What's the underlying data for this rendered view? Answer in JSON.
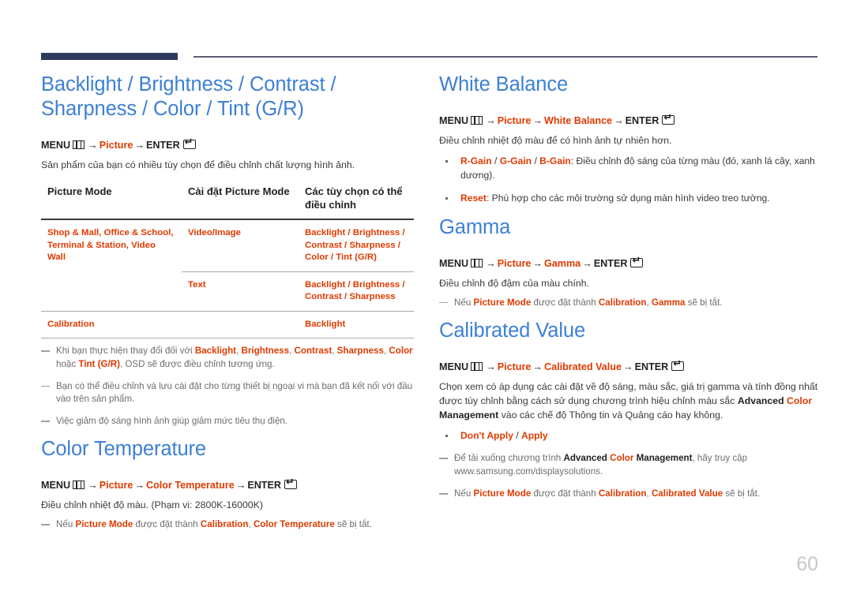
{
  "page": {
    "number": "60"
  },
  "icons": {
    "menu": "menu-icon",
    "enter": "enter-icon"
  },
  "labels": {
    "menu": "MENU",
    "enter": "ENTER",
    "arrow": "→",
    "picture": "Picture"
  },
  "colors": {
    "heading_blue": "#3d7fd6",
    "accent_red": "#e03a00",
    "header_bar_navy": "#2e3a5c",
    "rule_gray": "#5a5c75",
    "note_gray": "#6d6d6d",
    "page_number_gray": "#c6c6c6"
  },
  "left": {
    "backlight": {
      "title": "Backlight / Brightness / Contrast / Sharpness / Color / Tint (G/R)",
      "path": {
        "menu": "MENU",
        "item1": "Picture",
        "enter": "ENTER"
      },
      "intro": "Sản phẩm của bạn có nhiều tùy chọn để điều chỉnh chất lượng hình ảnh.",
      "table": {
        "headers": [
          "Picture Mode",
          "Cài đặt Picture Mode",
          "Các tùy chọn có thể điều chỉnh"
        ],
        "rows": [
          {
            "mode": "Shop & Mall, Office & School, Terminal & Station, Video Wall",
            "setting": "Video/Image",
            "options": "Backlight /  Brightness / Contrast / Sharpness / Color / Tint (G/R)"
          },
          {
            "mode": "",
            "setting": "Text",
            "options": "Backlight / Brightness / Contrast / Sharpness"
          },
          {
            "mode": "Calibration",
            "setting": "",
            "options": "Backlight"
          }
        ]
      },
      "notes": [
        "Khi bạn thực hiện thay đổi đối với Backlight, Brightness, Contrast, Sharpness, Color hoặc Tint (G/R), OSD sẽ được điều chỉnh tương ứng.",
        "Bạn có thể điều chỉnh và lưu cài đặt cho từng thiết bị ngoại vi mà bạn đã kết nối với đầu vào trên sản phẩm.",
        "Việc giảm độ sáng hình ảnh giúp giảm mức tiêu thụ điện."
      ]
    },
    "color_temperature": {
      "title": "Color Temperature",
      "path": {
        "menu": "MENU",
        "item1": "Picture",
        "item2": "Color Temperature",
        "enter": "ENTER"
      },
      "intro": "Điều chỉnh nhiệt độ màu. (Phạm vi: 2800K-16000K)",
      "note": "Nếu Picture Mode được đặt thành Calibration, Color Temperature sẽ bị tắt."
    }
  },
  "right": {
    "white_balance": {
      "title": "White Balance",
      "path": {
        "menu": "MENU",
        "item1": "Picture",
        "item2": "White Balance",
        "enter": "ENTER"
      },
      "intro": "Điều chỉnh nhiệt độ màu để có hình ảnh tự nhiên hơn.",
      "bullets": [
        "R-Gain / G-Gain / B-Gain: Điều chỉnh độ sáng của từng màu (đỏ, xanh lá cây, xanh dương).",
        "Reset: Phù hợp cho các môi trường sử dụng màn hình video treo tường."
      ]
    },
    "gamma": {
      "title": "Gamma",
      "path": {
        "menu": "MENU",
        "item1": "Picture",
        "item2": "Gamma",
        "enter": "ENTER"
      },
      "intro": "Điều chỉnh độ đậm của màu chính.",
      "note": "Nếu Picture Mode được đặt thành Calibration, Gamma sẽ bị tắt."
    },
    "calibrated_value": {
      "title": "Calibrated Value",
      "path": {
        "menu": "MENU",
        "item1": "Picture",
        "item2": "Calibrated Value",
        "enter": "ENTER"
      },
      "intro": "Chọn xem có áp dụng các cài đặt về độ sáng, màu sắc, giá trị gamma và tính đồng nhất được tùy chỉnh bằng cách sử dụng chương trình hiệu chỉnh màu sắc Advanced Color Management vào các chế độ Thông tin và Quảng cáo hay không.",
      "bullet": "Don't Apply / Apply",
      "notes": [
        "Để tải xuống chương trình Advanced Color Management, hãy truy cập www.samsung.com/displaysolutions.",
        "Nếu Picture Mode được đặt thành Calibration, Calibrated Value sẽ bị tắt."
      ]
    }
  }
}
